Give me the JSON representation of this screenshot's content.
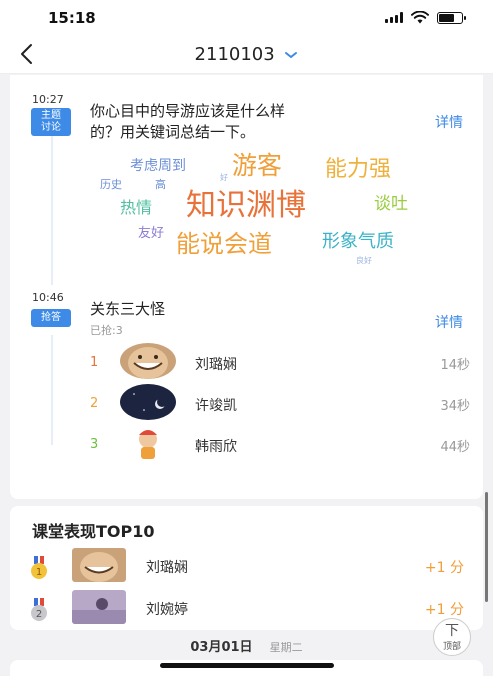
{
  "status": {
    "time": "15:18"
  },
  "nav": {
    "title": "2110103"
  },
  "post1": {
    "time": "10:27",
    "tag_line1": "主题",
    "tag_line2": "讨论",
    "text_line1": "你心目中的导游应该是什么样",
    "text_line2": "的？用关键词总结一下。",
    "detail": "详情"
  },
  "wordcloud": [
    {
      "text": "考虑周到",
      "color": "#6b8fd6"
    },
    {
      "text": "游客",
      "color": "#f0a03a"
    },
    {
      "text": "能力强",
      "color": "#f0b13c"
    },
    {
      "text": "历史",
      "color": "#6b8fd6"
    },
    {
      "text": "高",
      "color": "#6b8fd6"
    },
    {
      "text": "好",
      "color": "#9cb3e0"
    },
    {
      "text": "热情",
      "color": "#4fbf9f"
    },
    {
      "text": "知识渊博",
      "color": "#e8733a"
    },
    {
      "text": "谈吐",
      "color": "#9acc3f"
    },
    {
      "text": "友好",
      "color": "#8a7ed6"
    },
    {
      "text": "能说会道",
      "color": "#f0a03a"
    },
    {
      "text": "形象气质",
      "color": "#3bb3c7"
    },
    {
      "text": "良好",
      "color": "#9cb3e0"
    }
  ],
  "post2": {
    "time": "10:46",
    "tag": "抢答",
    "title": "关东三大怪",
    "sub": "已抢:3",
    "detail": "详情",
    "ranks": [
      {
        "num": "1",
        "name": "刘璐娴",
        "time": "14秒",
        "color": "#e8733a"
      },
      {
        "num": "2",
        "name": "许竣凯",
        "time": "34秒",
        "color": "#f0a03a"
      },
      {
        "num": "3",
        "name": "韩雨欣",
        "time": "44秒",
        "color": "#6dbf3f"
      }
    ]
  },
  "top10": {
    "title": "课堂表现TOP10",
    "rows": [
      {
        "name": "刘璐娴",
        "score": "+1 分",
        "medal": "1"
      },
      {
        "name": "刘婉婷",
        "score": "+1 分",
        "medal": "2"
      }
    ]
  },
  "date": {
    "main": "03月01日",
    "week": "星期二"
  },
  "top_btn": {
    "arrow": "下",
    "label": "顶部"
  },
  "colors": {
    "accent": "#3d8be6",
    "score": "#f29d38"
  }
}
